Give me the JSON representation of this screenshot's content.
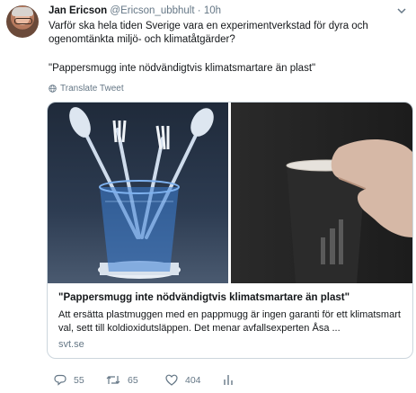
{
  "tweet": {
    "author_name": "Jan Ericson",
    "author_handle": "@Ericson_ubbhult",
    "separator": "·",
    "time": "10h",
    "text_line1": "Varför ska hela tiden Sverige vara en  experimentverkstad för dyra och",
    "text_line2": "ogenomtänkta miljö- och klimatåtgärder?",
    "quote_text": "\"Pappersmugg inte nödvändigtvis klimatsmartare än plast\"",
    "translate_label": "Translate Tweet"
  },
  "card": {
    "title": "\"Pappersmugg inte nödvändigtvis klimatsmartare än plast\"",
    "description": "Att ersätta plastmuggen med en pappmugg är ingen garanti för ett klimatsmart val, sett till koldioxidutsläppen. Det menar avfallsexperten Åsa ...",
    "domain": "svt.se"
  },
  "actions": {
    "reply_count": "55",
    "retweet_count": "65",
    "like_count": "404"
  },
  "icons": {
    "reply": "reply-icon",
    "retweet": "retweet-icon",
    "like": "heart-icon",
    "analytics": "analytics-icon",
    "translate": "globe-icon",
    "menu": "chevron-down-icon"
  },
  "colors": {
    "text": "#14171a",
    "secondary": "#657786",
    "border": "#ccd6dd"
  }
}
